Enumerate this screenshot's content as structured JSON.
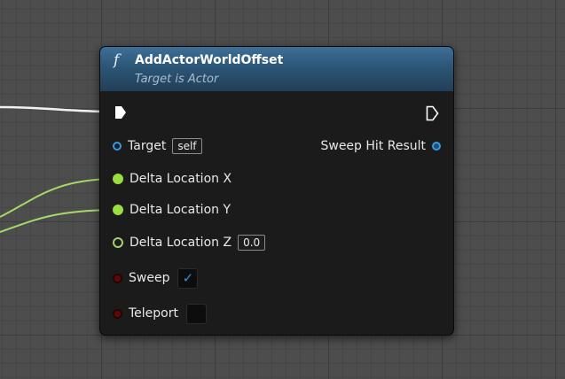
{
  "node": {
    "title": "AddActorWorldOffset",
    "subtitle": "Target is Actor",
    "func_icon": "f",
    "colors": {
      "header": "#2b5677",
      "object_pin": "#3a9bd9",
      "float_pin": "#9bde3f",
      "bool_pin": "#5c0a0a",
      "exec_pin": "#ffffff",
      "wire_exec": "#ffffff",
      "wire_float": "#a6d96a"
    },
    "exec_in": {
      "icon": "exec-in-pin-icon"
    },
    "exec_out": {
      "icon": "exec-out-pin-icon"
    },
    "inputs": [
      {
        "label": "Target",
        "type": "object",
        "value": "self"
      },
      {
        "label": "Delta Location X",
        "type": "float",
        "connected": true
      },
      {
        "label": "Delta Location Y",
        "type": "float",
        "connected": true
      },
      {
        "label": "Delta Location Z",
        "type": "float",
        "value": "0.0",
        "connected": false
      },
      {
        "label": "Sweep",
        "type": "bool",
        "checked": true
      },
      {
        "label": "Teleport",
        "type": "bool",
        "checked": false
      }
    ],
    "outputs": [
      {
        "label": "Sweep Hit Result",
        "type": "struct"
      }
    ]
  }
}
